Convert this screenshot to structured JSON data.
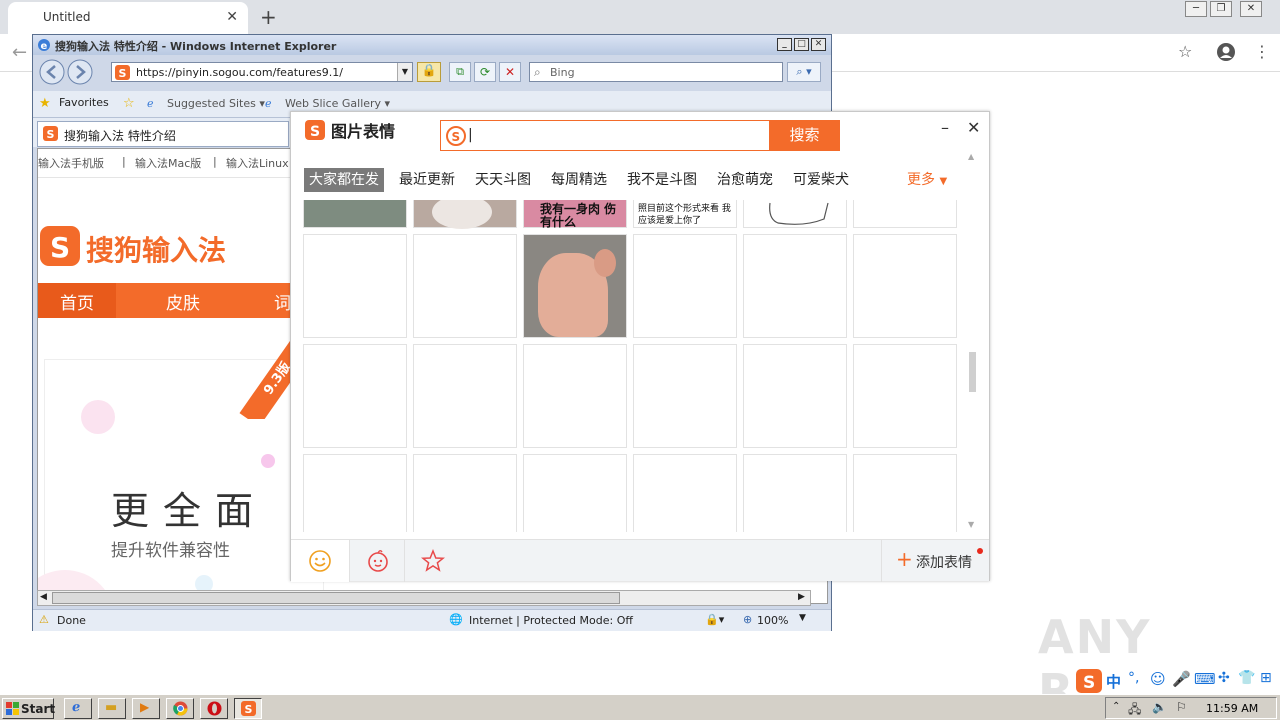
{
  "chrome": {
    "tab_title": "Untitled",
    "new_tab": "+"
  },
  "ie": {
    "title": "搜狗输入法 特性介绍 - Windows Internet Explorer",
    "url": "https://pinyin.sogou.com/features9.1/",
    "search_placeholder": "Bing",
    "favorites": "Favorites",
    "suggested_sites": "Suggested Sites ▾",
    "web_slice": "Web Slice Gallery ▾",
    "tab_title": "搜狗输入法 特性介绍",
    "status_done": "Done",
    "status_zone": "Internet | Protected Mode: Off",
    "zoom": "100%"
  },
  "sogou_page": {
    "top_links": [
      "输入法手机版",
      "|",
      "输入法Mac版",
      "|",
      "输入法Linux"
    ],
    "logo_text": "搜狗输入法",
    "nav": [
      "首页",
      "皮肤",
      "词"
    ],
    "version_badge": "9.3版",
    "banner_heading": "更全面",
    "banner_sub": "提升软件兼容性"
  },
  "emoji_panel": {
    "title": "图片表情",
    "search_value": "|",
    "search_button": "搜索",
    "categories": [
      "大家都在发",
      "最近更新",
      "天天斗图",
      "每周精选",
      "我不是斗图",
      "治愈萌宠",
      "可爱柴犬"
    ],
    "more": "更多",
    "meme_text_1": "我有一身肉 伤有什么",
    "meme_text_2": "照目前这个形式来看 我应该是爱上你了",
    "add_emoji": "添加表情"
  },
  "taskbar": {
    "start": "Start",
    "clock": "11:59 AM",
    "ime_lang": "中"
  },
  "watermark": "ANY RUN",
  "colors": {
    "sogou_orange": "#f36b2a",
    "ie_frame": "#cfd8e8"
  }
}
